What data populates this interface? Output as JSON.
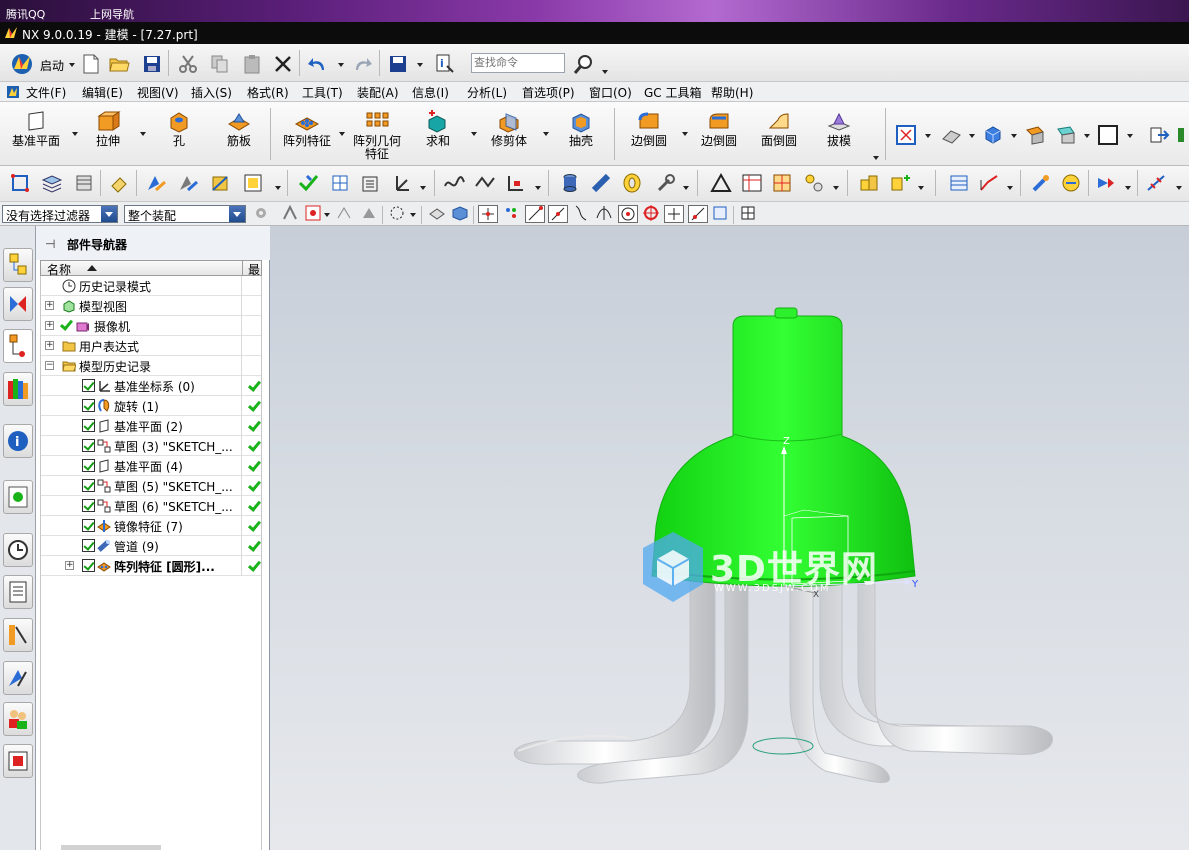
{
  "desktop": {
    "item1": "腾讯QQ",
    "item2": "上网导航"
  },
  "window": {
    "title": "NX 9.0.0.19 - 建模 - [7.27.prt]"
  },
  "toolbar": {
    "start_label": "启动",
    "search_placeholder": "查找命令"
  },
  "menu": [
    "文件(F)",
    "编辑(E)",
    "视图(V)",
    "插入(S)",
    "格式(R)",
    "工具(T)",
    "装配(A)",
    "信息(I)",
    "分析(L)",
    "首选项(P)",
    "窗口(O)",
    "GC 工具箱",
    "帮助(H)"
  ],
  "ribbon": {
    "datum_plane": "基准平面",
    "extrude": "拉伸",
    "hole": "孔",
    "rib": "筋板",
    "pattern_feature": "阵列特征",
    "pattern_geometry_1": "阵列几何",
    "pattern_geometry_2": "特征",
    "unite": "求和",
    "trim_body": "修剪体",
    "shell": "抽壳",
    "edge_blend_1": "边倒圆",
    "edge_blend_2": "边倒圆",
    "face_blend": "面倒圆",
    "draft": "拔模"
  },
  "filters": {
    "selection_filter": "没有选择过滤器",
    "assembly_scope": "整个装配"
  },
  "navigator": {
    "title": "部件导航器",
    "col_name": "名称",
    "col_latest": "最",
    "rows": [
      {
        "label": "历史记录模式"
      },
      {
        "label": "模型视图"
      },
      {
        "label": "摄像机"
      },
      {
        "label": "用户表达式"
      },
      {
        "label": "模型历史记录"
      },
      {
        "label": "基准坐标系 (0)"
      },
      {
        "label": "旋转 (1)"
      },
      {
        "label": "基准平面 (2)"
      },
      {
        "label": "草图 (3) \"SKETCH_..."
      },
      {
        "label": "基准平面 (4)"
      },
      {
        "label": "草图 (5) \"SKETCH_..."
      },
      {
        "label": "草图 (6) \"SKETCH_..."
      },
      {
        "label": "镜像特征 (7)"
      },
      {
        "label": "管道 (9)"
      },
      {
        "label": "阵列特征 [圆形]..."
      }
    ]
  },
  "viewport": {
    "axis_z": "Z",
    "axis_y": "Y",
    "axis_x": "X"
  },
  "watermark": {
    "brand": "3D世界网",
    "url": "WWW.3DSJW.COM"
  },
  "colors": {
    "model_green": "#22ee22",
    "pipe_white": "#f4f4f4",
    "check_green": "#19b319"
  }
}
